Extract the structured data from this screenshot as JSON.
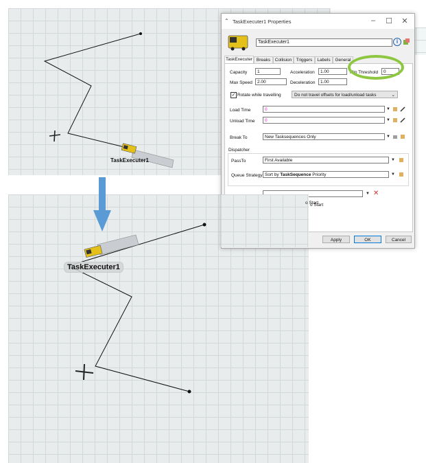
{
  "scene_top": {
    "label": "TaskExecuter1"
  },
  "scene_bottom": {
    "label": "TaskExecuter1"
  },
  "dialog": {
    "title": "TaskExecuter1 Properties",
    "name_value": "TaskExecuter1",
    "tabs": [
      "TaskExecuter",
      "Breaks",
      "Collision",
      "Triggers",
      "Labels",
      "General"
    ],
    "capacity_label": "Capacity",
    "capacity_value": "1",
    "acceleration_label": "Acceleration",
    "acceleration_value": "1.00",
    "flip_label": "Flip Threshold",
    "flip_value": "0",
    "maxspeed_label": "Max Speed",
    "maxspeed_value": "2.00",
    "deceleration_label": "Deceleration",
    "deceleration_value": "1.00",
    "rotate_label": "Rotate while travelling",
    "travel_offset_value": "Do not travel offsets for load/unload tasks",
    "load_time_label": "Load Time",
    "load_time_value": "0",
    "unload_time_label": "Unload Time",
    "unload_time_value": "0",
    "break_to_label": "Break To",
    "break_to_value": "New Tasksequences Only",
    "dispatcher_label": "Dispatcher",
    "passto_label": "PassTo",
    "passto_value": "First Available",
    "queue_label": "Queue Strategy",
    "queue_prefix": "Sort by ",
    "queue_bold": "TaskSequence",
    "queue_suffix": " Priority",
    "start_text": "o Start",
    "apply": "Apply",
    "ok": "OK",
    "cancel": "Cancel",
    "colors": {
      "highlight_ring": "#8dc63f",
      "arrow": "#5b9bd5",
      "pink_value": "#d81bd8"
    }
  }
}
